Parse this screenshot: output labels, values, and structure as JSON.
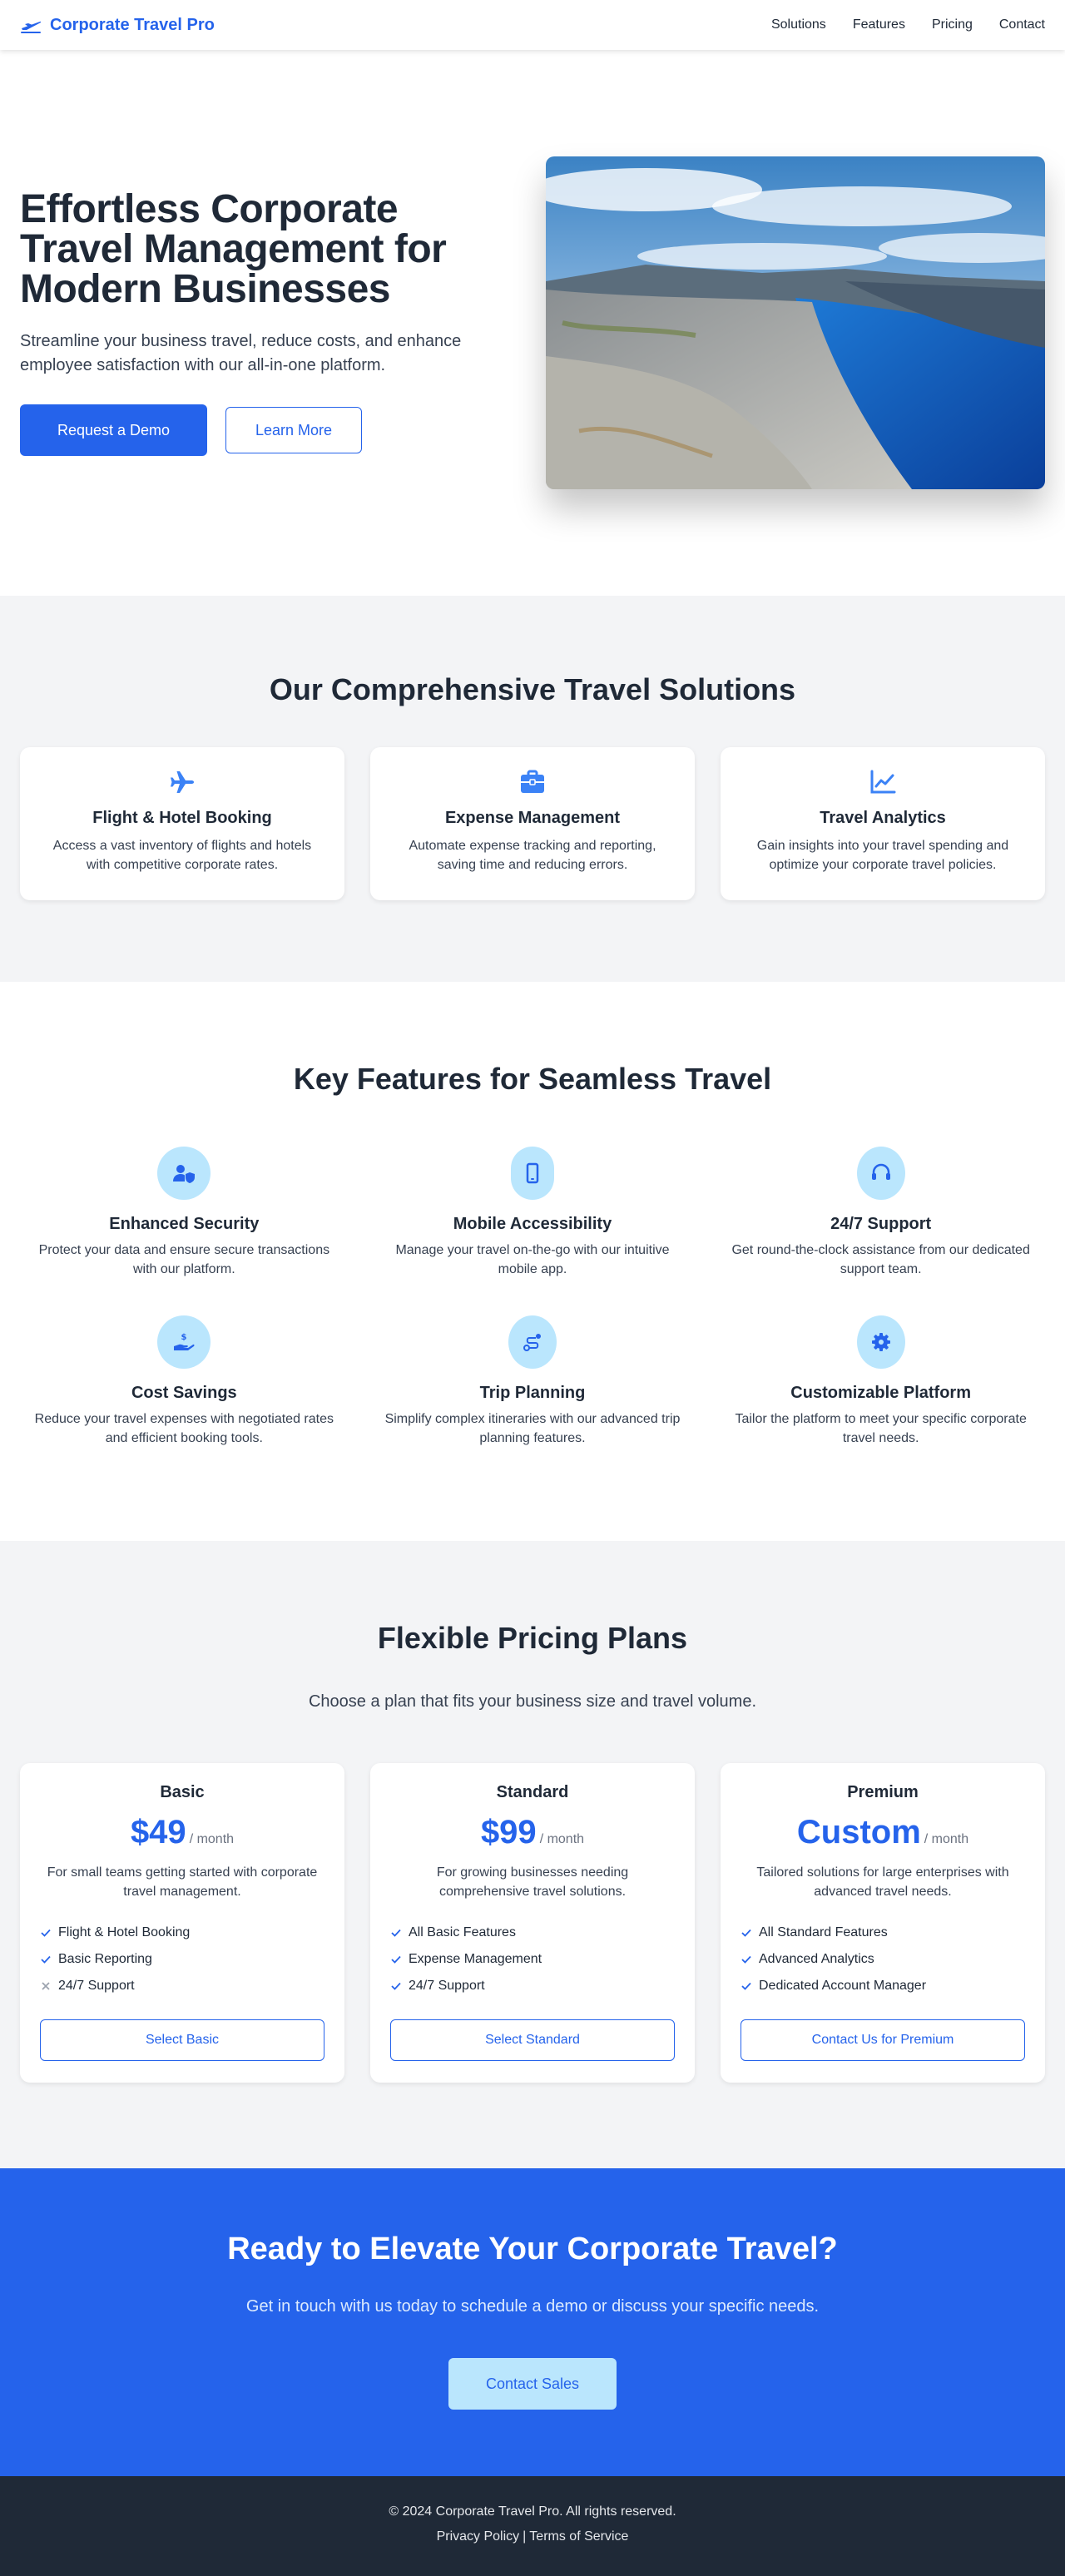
{
  "brand": {
    "name": "Corporate Travel Pro",
    "icon": "plane-icon",
    "accent": "#2563eb"
  },
  "nav": [
    "Solutions",
    "Features",
    "Pricing",
    "Contact"
  ],
  "hero": {
    "title": "Effortless Corporate Travel Management for Modern Businesses",
    "subtitle": "Streamline your business travel, reduce costs, and enhance employee satisfaction with our all-in-one platform.",
    "primary_button": "Request a Demo",
    "secondary_button": "Learn More",
    "image": "fjord-landscape-photo"
  },
  "solutions": {
    "title": "Our Comprehensive Travel Solutions",
    "cards": [
      {
        "icon": "plane-icon",
        "title": "Flight & Hotel Booking",
        "text": "Access a vast inventory of flights and hotels with competitive corporate rates."
      },
      {
        "icon": "briefcase-icon",
        "title": "Expense Management",
        "text": "Automate expense tracking and reporting, saving time and reducing errors."
      },
      {
        "icon": "chart-line-icon",
        "title": "Travel Analytics",
        "text": "Gain insights into your travel spending and optimize your corporate travel policies."
      }
    ]
  },
  "features": {
    "title": "Key Features for Seamless Travel",
    "items": [
      {
        "icon": "user-shield-icon",
        "title": "Enhanced Security",
        "text": "Protect your data and ensure secure transactions with our platform."
      },
      {
        "icon": "mobile-icon",
        "title": "Mobile Accessibility",
        "text": "Manage your travel on-the-go with our intuitive mobile app."
      },
      {
        "icon": "headset-icon",
        "title": "24/7 Support",
        "text": "Get round-the-clock assistance from our dedicated support team."
      },
      {
        "icon": "hand-holding-dollar-icon",
        "title": "Cost Savings",
        "text": "Reduce your travel expenses with negotiated rates and efficient booking tools."
      },
      {
        "icon": "route-icon",
        "title": "Trip Planning",
        "text": "Simplify complex itineraries with our advanced trip planning features."
      },
      {
        "icon": "gear-icon",
        "title": "Customizable Platform",
        "text": "Tailor the platform to meet your specific corporate travel needs."
      }
    ]
  },
  "pricing": {
    "title": "Flexible Pricing Plans",
    "subtitle": "Choose a plan that fits your business size and travel volume.",
    "plans": [
      {
        "name": "Basic",
        "price": "$49",
        "per": "/ month",
        "desc": "For small teams getting started with corporate travel management.",
        "features": [
          {
            "text": "Flight & Hotel Booking",
            "included": true
          },
          {
            "text": "Basic Reporting",
            "included": true
          },
          {
            "text": "24/7 Support",
            "included": false
          }
        ],
        "button": "Select Basic"
      },
      {
        "name": "Standard",
        "price": "$99",
        "per": "/ month",
        "desc": "For growing businesses needing comprehensive travel solutions.",
        "features": [
          {
            "text": "All Basic Features",
            "included": true
          },
          {
            "text": "Expense Management",
            "included": true
          },
          {
            "text": "24/7 Support",
            "included": true
          }
        ],
        "button": "Select Standard"
      },
      {
        "name": "Premium",
        "price": "Custom",
        "per": "/ month",
        "desc": "Tailored solutions for large enterprises with advanced travel needs.",
        "features": [
          {
            "text": "All Standard Features",
            "included": true
          },
          {
            "text": "Advanced Analytics",
            "included": true
          },
          {
            "text": "Dedicated Account Manager",
            "included": true
          }
        ],
        "button": "Contact Us for Premium"
      }
    ]
  },
  "cta": {
    "title": "Ready to Elevate Your Corporate Travel?",
    "subtitle": "Get in touch with us today to schedule a demo or discuss your specific needs.",
    "button": "Contact Sales"
  },
  "footer": {
    "copyright": "© 2024 Corporate Travel Pro. All rights reserved.",
    "privacy": "Privacy Policy",
    "separator": "|",
    "terms": "Terms of Service"
  }
}
